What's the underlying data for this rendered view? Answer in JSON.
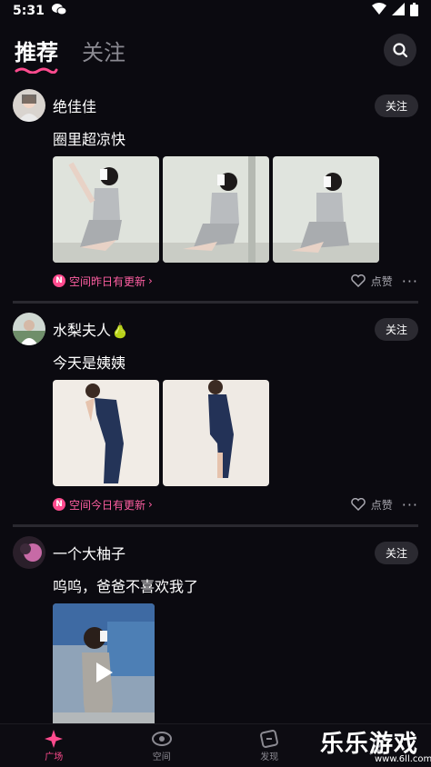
{
  "status": {
    "time": "5:31"
  },
  "tabs": [
    {
      "label": "推荐",
      "active": true
    },
    {
      "label": "关注",
      "active": false
    }
  ],
  "posts": [
    {
      "username": "绝佳佳",
      "follow_label": "关注",
      "text": "圈里超凉快",
      "space_text": "空间昨日有更新",
      "like_label": "点赞"
    },
    {
      "username": "水梨夫人🍐",
      "follow_label": "关注",
      "text": "今天是姨姨",
      "space_text": "空间今日有更新",
      "like_label": "点赞"
    },
    {
      "username": "一个大柚子",
      "follow_label": "关注",
      "text": "呜呜，爸爸不喜欢我了"
    }
  ],
  "bottom_nav": [
    {
      "label": "广场",
      "icon": "sparkle-icon",
      "active": true
    },
    {
      "label": "空间",
      "icon": "space-icon",
      "active": false
    },
    {
      "label": "发现",
      "icon": "discover-icon",
      "active": false
    },
    {
      "label": "",
      "icon": "profile-icon",
      "active": false
    }
  ],
  "watermark": {
    "text": "乐乐游戏",
    "url": "www.6ll.com"
  },
  "colors": {
    "accent": "#ff4b8e",
    "background": "#0b0a10"
  }
}
